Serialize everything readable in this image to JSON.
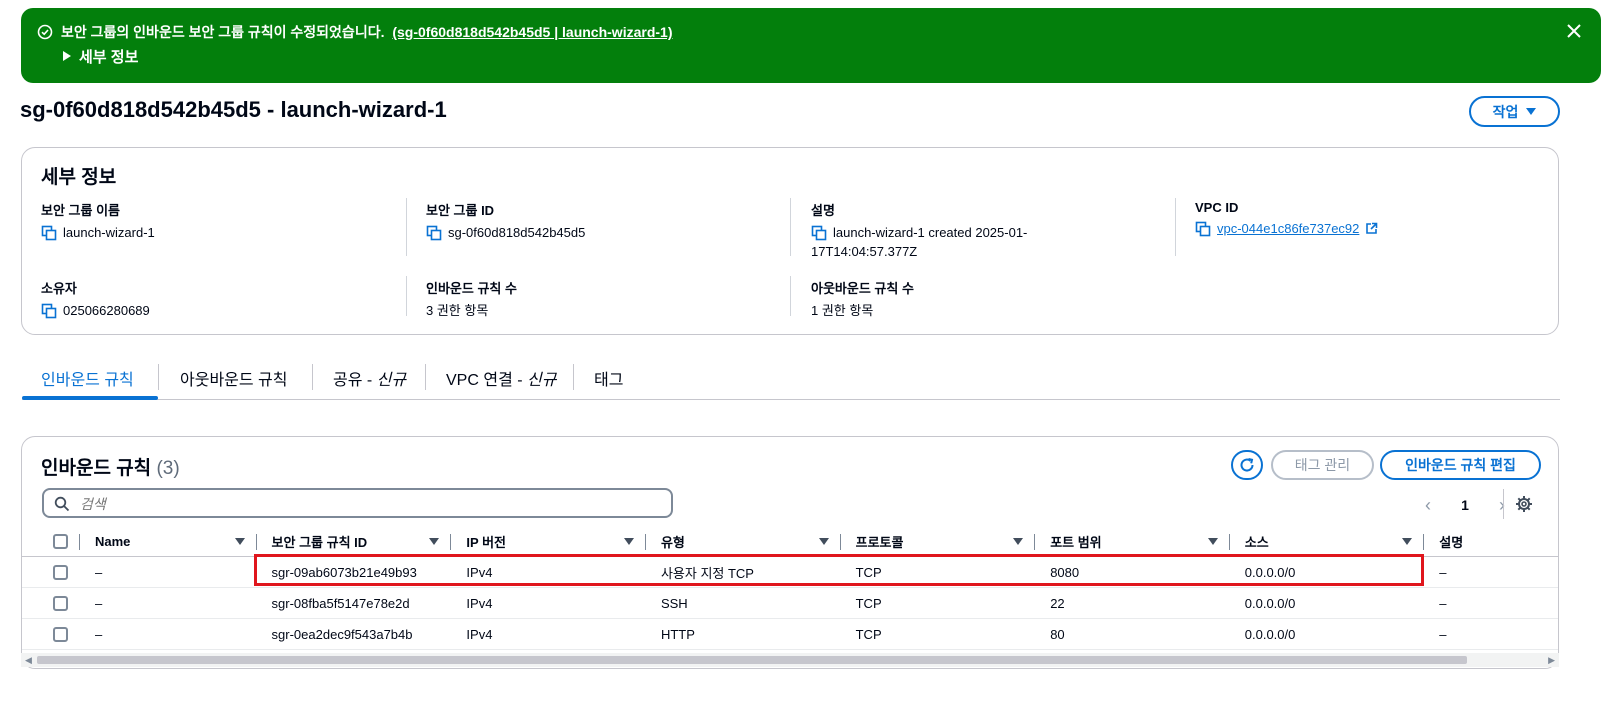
{
  "flash": {
    "message": "보안 그룹의 인바운드 보안 그룹 규칙이 수정되었습니다.",
    "link": "(sg-0f60d818d542b45d5 | launch-wizard-1)",
    "details_label": "세부 정보",
    "color": "#037f0c"
  },
  "header": {
    "title": "sg-0f60d818d542b45d5 - launch-wizard-1",
    "actions_label": "작업"
  },
  "details": {
    "heading": "세부 정보",
    "sg_name_label": "보안 그룹 이름",
    "sg_name": "launch-wizard-1",
    "sg_id_label": "보안 그룹 ID",
    "sg_id": "sg-0f60d818d542b45d5",
    "desc_label": "설명",
    "desc_line1": "launch-wizard-1 created 2025-01-",
    "desc_line2": "17T14:04:57.377Z",
    "vpc_label": "VPC ID",
    "vpc_id": "vpc-044e1c86fe737ec92",
    "owner_label": "소유자",
    "owner": "025066280689",
    "inbound_count_label": "인바운드 규칙 수",
    "inbound_count": "3 권한 항목",
    "outbound_count_label": "아웃바운드 규칙 수",
    "outbound_count": "1 권한 항목"
  },
  "tabs": [
    {
      "label": "인바운드 규칙",
      "suffix": ""
    },
    {
      "label": "아웃바운드 규칙",
      "suffix": ""
    },
    {
      "label": "공유 - ",
      "suffix": "신규"
    },
    {
      "label": "VPC 연결 - ",
      "suffix": "신규"
    },
    {
      "label": "태그",
      "suffix": ""
    }
  ],
  "rules": {
    "title": "인바운드 규칙",
    "count": "(3)",
    "tag_manage_label": "태그 관리",
    "edit_label": "인바운드 규칙 편집",
    "search_placeholder": "검색",
    "page": "1",
    "columns": [
      "Name",
      "보안 그룹 규칙 ID",
      "IP 버전",
      "유형",
      "프로토콜",
      "포트 범위",
      "소스",
      "설명"
    ],
    "rows": [
      {
        "name": "–",
        "id": "sgr-09ab6073b21e49b93",
        "ip": "IPv4",
        "type": "사용자 지정 TCP",
        "protocol": "TCP",
        "port": "8080",
        "source": "0.0.0.0/0",
        "desc": "–"
      },
      {
        "name": "–",
        "id": "sgr-08fba5f5147e78e2d",
        "ip": "IPv4",
        "type": "SSH",
        "protocol": "TCP",
        "port": "22",
        "source": "0.0.0.0/0",
        "desc": "–"
      },
      {
        "name": "–",
        "id": "sgr-0ea2dec9f543a7b4b",
        "ip": "IPv4",
        "type": "HTTP",
        "protocol": "TCP",
        "port": "80",
        "source": "0.0.0.0/0",
        "desc": "–"
      }
    ]
  },
  "colors": {
    "accent": "#0972d3",
    "highlight": "#e0161d"
  }
}
